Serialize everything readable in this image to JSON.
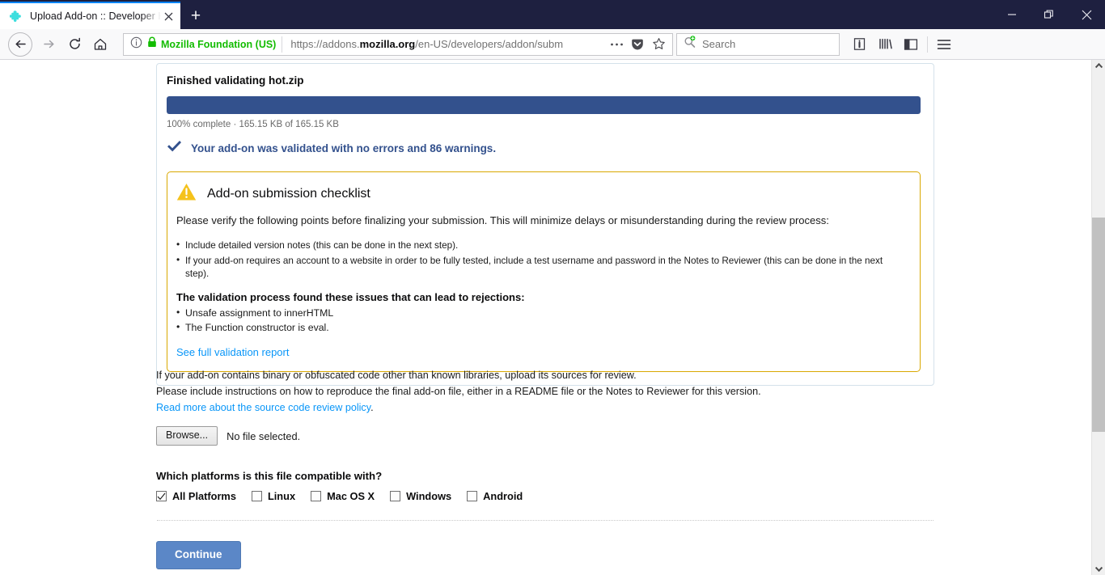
{
  "window": {
    "minimize_label": "Minimize",
    "restore_label": "Restore",
    "close_label": "Close"
  },
  "tabs": [
    {
      "title": "Upload Add-on :: Developer Hub",
      "favicon": "puzzle-piece-icon",
      "active": true
    }
  ],
  "newtab_label": "+",
  "toolbar": {
    "back_label": "Back",
    "forward_label": "Forward",
    "reload_label": "Reload",
    "home_label": "Home",
    "identity": {
      "name": "Mozilla Foundation (US)",
      "info_icon": "info-circle-icon",
      "lock_icon": "padlock-icon",
      "color": "#12bc00"
    },
    "url": {
      "prefix": "https://addons.",
      "bold": "mozilla.org",
      "suffix": "/en-US/developers/addon/subm"
    },
    "page_actions_label": "•••",
    "pocket_label": "Save to Pocket",
    "bookmark_label": "Bookmark this page",
    "page_info_label": "Page info",
    "library_label": "Library",
    "sidebar_label": "Sidebars",
    "menu_label": "Open menu"
  },
  "search": {
    "placeholder": "Search",
    "icon": "search-add-icon"
  },
  "upload_card": {
    "title": "Finished validating hot.zip",
    "progress": {
      "percent": 100,
      "meta": "100% complete · 165.15 KB of 165.15 KB",
      "fill_color": "#33518d"
    },
    "validated_message": "Your add-on was validated with no errors and 86 warnings.",
    "validated_icon": "checkmark-icon"
  },
  "checklist": {
    "icon": "warning-triangle-icon",
    "heading": "Add-on submission checklist",
    "intro": "Please verify the following points before finalizing your submission. This will minimize delays or misunderstanding during the review process:",
    "points": [
      "Include detailed version notes (this can be done in the next step).",
      "If your add-on requires an account to a website in order to be fully tested, include a test username and password in the Notes to Reviewer (this can be done in the next step)."
    ],
    "issues_heading": "The validation process found these issues that can lead to rejections:",
    "issues": [
      "Unsafe assignment to innerHTML",
      "The Function constructor is eval."
    ],
    "report_link": "See full validation report",
    "border_color": "#d9a800"
  },
  "source": {
    "line1": "If your add-on contains binary or obfuscated code other than known libraries, upload its sources for review.",
    "line2": "Please include instructions on how to reproduce the final add-on file, either in a README file or the Notes to Reviewer for this version.",
    "policy_link": "Read more about the source code review policy",
    "policy_period": ".",
    "browse_label": "Browse...",
    "file_status": "No file selected."
  },
  "platforms": {
    "question": "Which platforms is this file compatible with?",
    "options": [
      {
        "label": "All Platforms",
        "checked": true
      },
      {
        "label": "Linux",
        "checked": false
      },
      {
        "label": "Mac OS X",
        "checked": false
      },
      {
        "label": "Windows",
        "checked": false
      },
      {
        "label": "Android",
        "checked": false
      }
    ]
  },
  "footer": {
    "continue_label": "Continue",
    "continue_color": "#5b87c7"
  }
}
